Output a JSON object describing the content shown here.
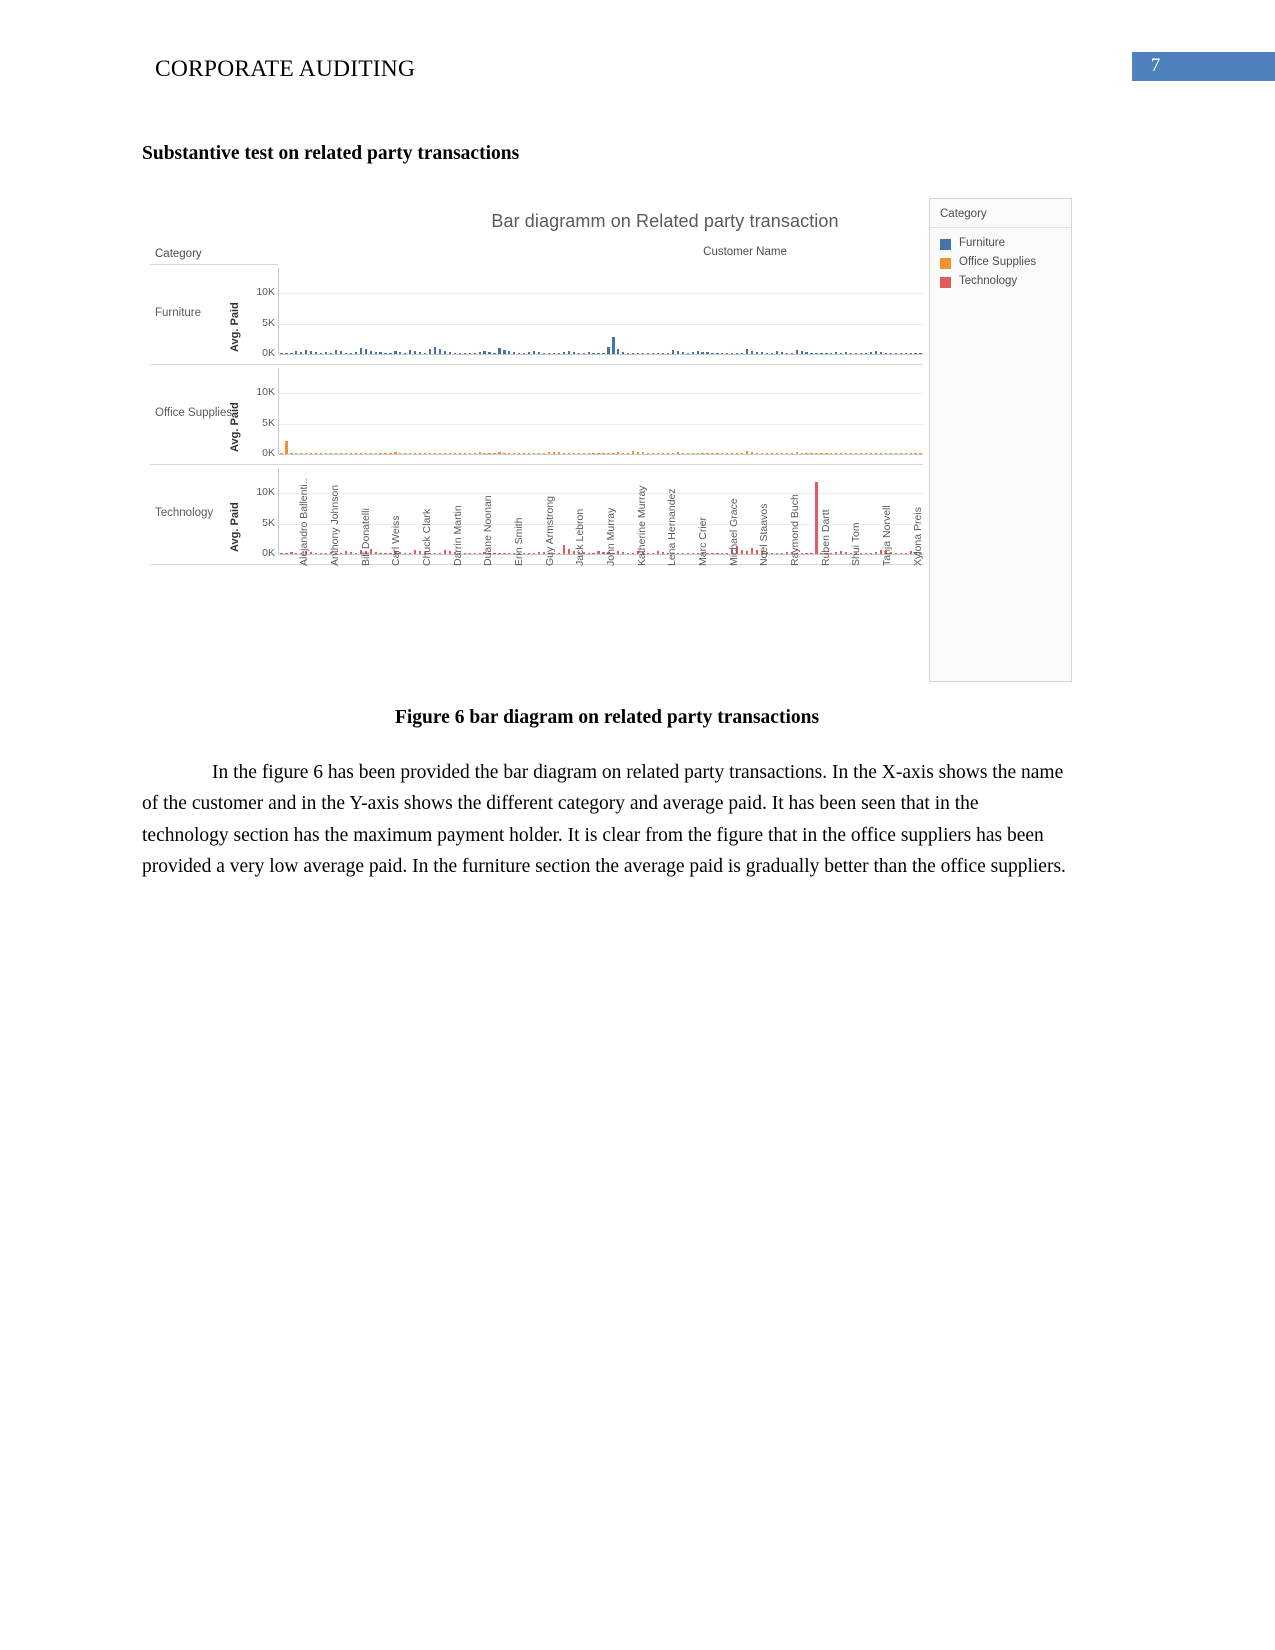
{
  "header": {
    "title": "CORPORATE AUDITING",
    "page_number": "7",
    "accent_color": "#4f81bd"
  },
  "section_heading": "Substantive test on related party transactions",
  "figure_caption": "Figure 6 bar diagram on related party transactions",
  "body_paragraph": "In the figure 6 has been provided the bar diagram on related party transactions. In the X-axis shows the name of the customer and in the Y-axis shows the different category and average paid. It has been seen that in the technology section has the maximum payment holder. It is clear from the figure that in the office suppliers has been provided a very low average paid. In the furniture section the average paid is gradually better than the office suppliers.",
  "legend": {
    "title": "Category",
    "items": [
      {
        "label": "Furniture",
        "color": "#4574a8"
      },
      {
        "label": "Office Supplies",
        "color": "#f2912e"
      },
      {
        "label": "Technology",
        "color": "#e05c5f"
      }
    ]
  },
  "chart_data": {
    "type": "bar",
    "title": "Bar diagramm on Related party transaction",
    "row_field_label": "Category",
    "column_header_label": "Customer Name",
    "xlabel": "Customer Name",
    "ylabel": "Avg. Paid",
    "ylim": [
      0,
      12500
    ],
    "yticks": [
      0,
      5000,
      10000
    ],
    "ytick_labels": [
      "0K",
      "5K",
      "10K"
    ],
    "grid": true,
    "legend_position": "right",
    "categories": [
      "Alejandro Ballenti..",
      "Anthony Johnson",
      "Bill Donatelli",
      "Carl Weiss",
      "Chuck Clark",
      "Darrin Martin",
      "Duane Noonan",
      "Erin Smith",
      "Guy Armstrong",
      "Jack Lebron",
      "John Murray",
      "Katherine Murray",
      "Lena Hernandez",
      "Marc Crier",
      "Michael Grace",
      "Noel Staavos",
      "Raymond Buch",
      "Ruben Dartt",
      "Shui Tom",
      "Tanja Norvell",
      "Xylona Preis"
    ],
    "panels": [
      {
        "name": "Furniture",
        "color": "#4574a8",
        "values": [
          60,
          120,
          90,
          430,
          260,
          700,
          520,
          380,
          240,
          300,
          180,
          620,
          430,
          240,
          160,
          320,
          980,
          760,
          520,
          260,
          340,
          180,
          120,
          420,
          300,
          180,
          640,
          420,
          260,
          180,
          880,
          1180,
          760,
          520,
          340,
          220,
          180,
          120,
          90,
          140,
          260,
          420,
          300,
          180,
          960,
          640,
          420,
          260,
          180,
          120,
          340,
          520,
          260,
          180,
          120,
          90,
          240,
          380,
          520,
          260,
          180,
          120,
          300,
          180,
          240,
          160,
          1120,
          2750,
          820,
          300,
          180,
          120,
          90,
          60,
          140,
          220,
          180,
          120,
          90,
          640,
          420,
          260,
          180,
          320,
          520,
          380,
          260,
          180,
          120,
          240,
          180,
          120,
          90,
          160,
          820,
          560,
          380,
          260,
          180,
          120,
          420,
          300,
          180,
          240,
          680,
          520,
          360,
          240,
          180,
          120,
          140,
          90,
          260,
          180,
          380,
          240,
          160,
          120,
          80,
          340,
          520,
          300,
          180,
          120,
          80,
          60,
          240,
          180,
          120,
          90
        ]
      },
      {
        "name": "Office Supplies",
        "color": "#f2912e",
        "values": [
          40,
          2100,
          80,
          60,
          40,
          30,
          60,
          40,
          30,
          50,
          40,
          30,
          180,
          220,
          160,
          120,
          80,
          60,
          40,
          30,
          60,
          40,
          200,
          260,
          180,
          140,
          100,
          240,
          180,
          120,
          90,
          60,
          40,
          30,
          60,
          40,
          30,
          20,
          40,
          30,
          260,
          180,
          120,
          90,
          300,
          220,
          160,
          120,
          80,
          60,
          40,
          160,
          120,
          90,
          260,
          380,
          280,
          200,
          160,
          120,
          90,
          60,
          220,
          160,
          120,
          90,
          60,
          40,
          280,
          200,
          160,
          420,
          340,
          260,
          180,
          120,
          90,
          60,
          40,
          30,
          260,
          180,
          120,
          90,
          60,
          40,
          160,
          120,
          90,
          60,
          40,
          30,
          180,
          240,
          420,
          300,
          220,
          160,
          120,
          90,
          60,
          40,
          30,
          180,
          260,
          180,
          120,
          90,
          60,
          40,
          30,
          20,
          160,
          120,
          90,
          60,
          40,
          30,
          20,
          180,
          240,
          160,
          120,
          90,
          60,
          40,
          30,
          20,
          40,
          30
        ]
      },
      {
        "name": "Technology",
        "color": "#e05c5f",
        "values": [
          60,
          40,
          380,
          180,
          120,
          420,
          300,
          180,
          90,
          60,
          260,
          180,
          120,
          560,
          340,
          220,
          680,
          420,
          780,
          320,
          180,
          120,
          90,
          520,
          360,
          240,
          160,
          620,
          440,
          280,
          180,
          120,
          90,
          740,
          500,
          340,
          220,
          160,
          120,
          90,
          60,
          280,
          180,
          120,
          90,
          60,
          180,
          120,
          90,
          60,
          160,
          120,
          380,
          260,
          180,
          120,
          90,
          1450,
          820,
          560,
          380,
          260,
          180,
          120,
          560,
          380,
          260,
          180,
          420,
          300,
          200,
          140,
          520,
          360,
          240,
          160,
          420,
          280,
          190,
          130,
          90,
          60,
          220,
          160,
          120,
          80,
          60,
          40,
          120,
          90,
          60,
          780,
          1250,
          640,
          420,
          1050,
          720,
          480,
          320,
          220,
          160,
          120,
          380,
          260,
          180,
          120,
          90,
          60,
          11800,
          180,
          120,
          90,
          260,
          520,
          340,
          220,
          160,
          120,
          80,
          60,
          380,
          620,
          420,
          280,
          190,
          130,
          90,
          420,
          280,
          180
        ]
      }
    ]
  }
}
